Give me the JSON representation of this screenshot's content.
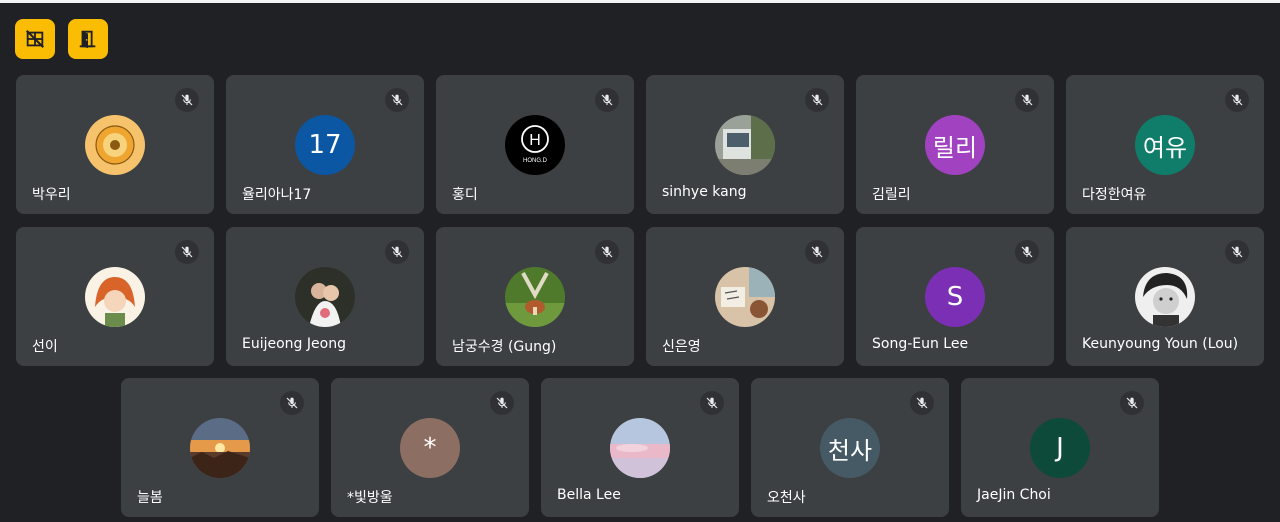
{
  "toolbar": {
    "buttons": [
      {
        "name": "hide-tiles-button",
        "icon": "hidden-grid-icon"
      },
      {
        "name": "leave-call-button",
        "icon": "door-exit-icon"
      }
    ]
  },
  "colors": {
    "background": "#202124",
    "tile": "#3c4043",
    "accent": "#fbbc04"
  },
  "participants": [
    {
      "name": "박우리",
      "avatar_text": "",
      "avatar_color": "#f6c26b",
      "muted": true
    },
    {
      "name": "율리아나17",
      "avatar_text": "17",
      "avatar_color": "#0b57a4",
      "muted": true
    },
    {
      "name": "홍디",
      "avatar_text": "",
      "avatar_color": "#000000",
      "logo_letter": "H",
      "logo_text": "HONG.D",
      "muted": true
    },
    {
      "name": "sinhye kang",
      "avatar_text": "",
      "avatar_color": "#6d7468",
      "muted": true
    },
    {
      "name": "김릴리",
      "avatar_text": "릴리",
      "avatar_color": "#a142c0",
      "muted": true
    },
    {
      "name": "다정한여유",
      "avatar_text": "여유",
      "avatar_color": "#0f7d6a",
      "muted": true
    },
    {
      "name": "선이",
      "avatar_text": "",
      "avatar_color": "#f1e3d2",
      "muted": true
    },
    {
      "name": "Euijeong Jeong",
      "avatar_text": "",
      "avatar_color": "#3b3f36",
      "muted": true
    },
    {
      "name": "남궁수경 (Gung)",
      "avatar_text": "",
      "avatar_color": "#5a7a35",
      "muted": true
    },
    {
      "name": "신은영",
      "avatar_text": "",
      "avatar_color": "#c9a98a",
      "muted": true
    },
    {
      "name": "Song-Eun Lee",
      "avatar_text": "S",
      "avatar_color": "#7b2fb5",
      "muted": true
    },
    {
      "name": "Keunyoung Youn (Lou)",
      "avatar_text": "",
      "avatar_color": "#e8e8e8",
      "muted": true
    },
    {
      "name": "늘봄",
      "avatar_text": "",
      "avatar_color": "#6b4a3a",
      "muted": true
    },
    {
      "name": "*빛방울",
      "avatar_text": "*",
      "avatar_color": "#8d6e63",
      "muted": true
    },
    {
      "name": "Bella Lee",
      "avatar_text": "",
      "avatar_color": "#e6b6c6",
      "muted": true
    },
    {
      "name": "오천사",
      "avatar_text": "천사",
      "avatar_color": "#455a64",
      "muted": true
    },
    {
      "name": "JaeJin Choi",
      "avatar_text": "J",
      "avatar_color": "#0d4a3a",
      "muted": true
    }
  ]
}
